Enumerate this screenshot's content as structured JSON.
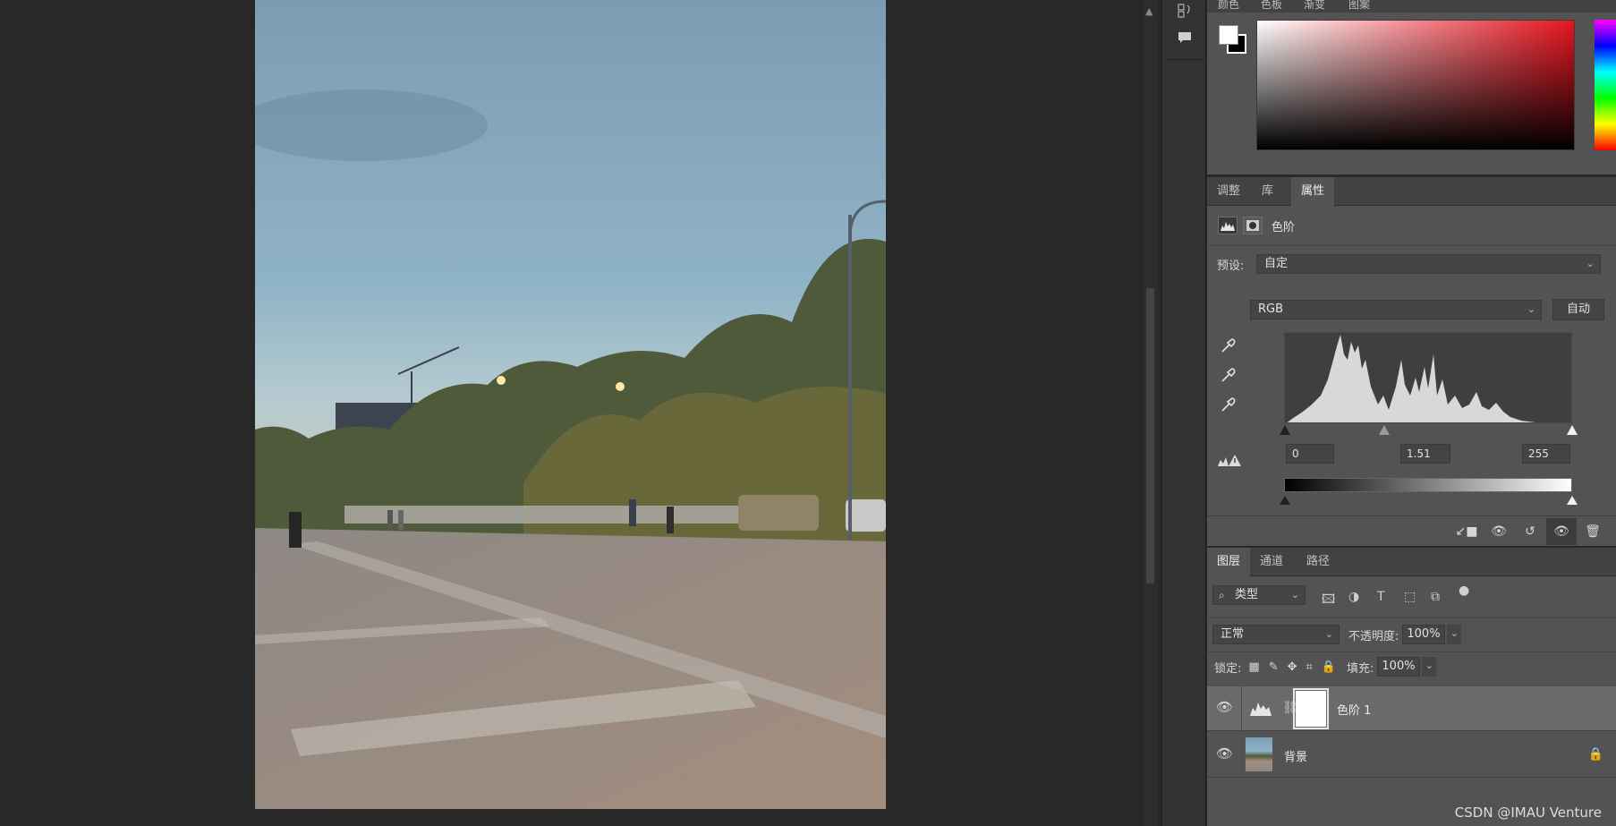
{
  "color_panel": {
    "tabs": [
      "颜色",
      "色板",
      "渐变",
      "图案"
    ],
    "accent_color": "#e8141f"
  },
  "properties": {
    "tabs": [
      "调整",
      "库",
      "属性"
    ],
    "active_tab": "属性",
    "adjustment_title": "色阶",
    "preset_label": "预设:",
    "preset_value": "自定",
    "channel_value": "RGB",
    "auto_button": "自动",
    "input_black": "0",
    "input_gamma": "1.51",
    "input_white": "255"
  },
  "layers": {
    "tabs": [
      "图层",
      "通道",
      "路径"
    ],
    "active_tab": "图层",
    "filter_label": "类型",
    "blend_mode": "正常",
    "opacity_label": "不透明度:",
    "opacity_value": "100%",
    "lock_label": "锁定:",
    "fill_label": "填充:",
    "fill_value": "100%",
    "items": [
      {
        "name": "色阶 1",
        "type": "adjustment",
        "visible": true,
        "selected": true
      },
      {
        "name": "背景",
        "type": "image",
        "visible": true,
        "locked": true
      }
    ]
  },
  "watermark": "CSDN @IMAU Venture"
}
